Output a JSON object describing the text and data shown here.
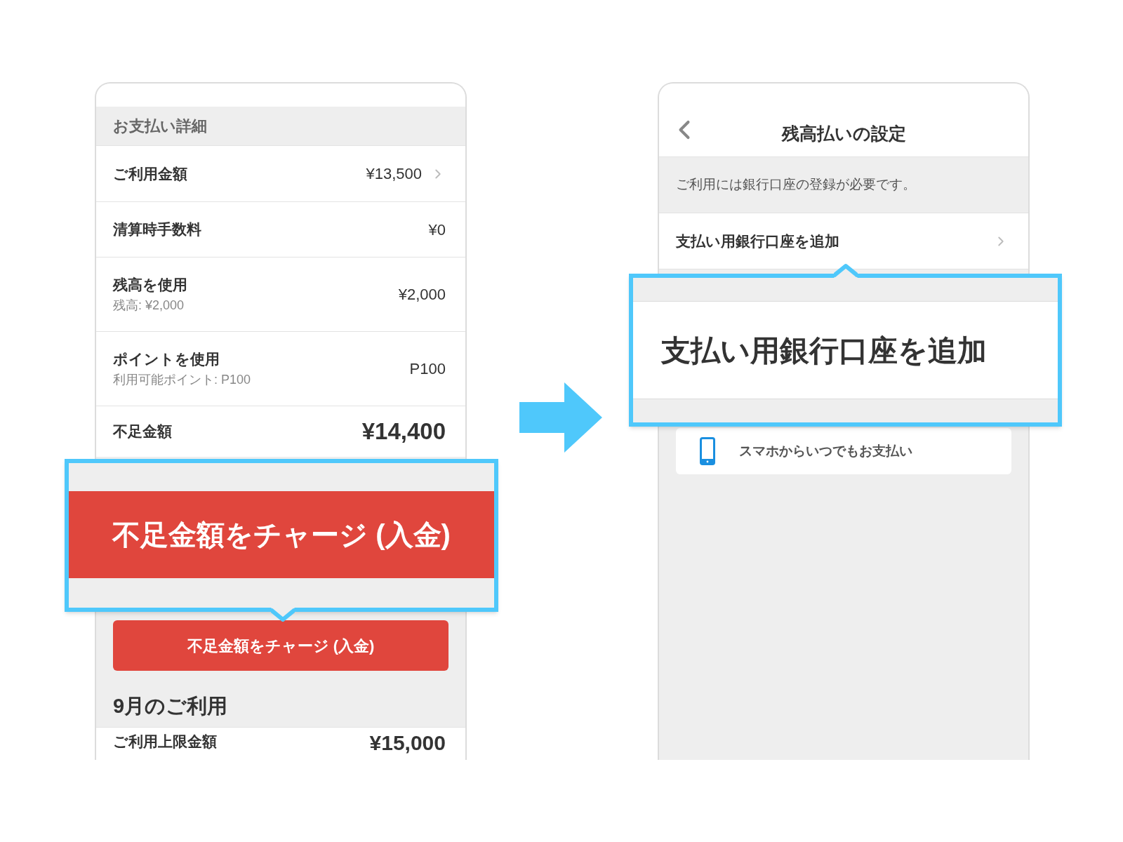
{
  "left_screen": {
    "section_header": "お支払い詳細",
    "rows": [
      {
        "kind": "link",
        "label": "ご利用金額",
        "value": "¥13,500"
      },
      {
        "kind": "plain",
        "label": "清算時手数料",
        "value": "¥0"
      },
      {
        "kind": "sub",
        "label": "残高を使用",
        "sublabel": "残高: ¥2,000",
        "value": "¥2,000"
      },
      {
        "kind": "sub",
        "label": "ポイントを使用",
        "sublabel": "利用可能ポイント: P100",
        "value": "P100"
      },
      {
        "kind": "total",
        "label": "不足金額",
        "value": "¥14,400"
      }
    ],
    "charge_button": "不足金額をチャージ (入金)",
    "month_header": "9月のご利用",
    "limit_row": {
      "label": "ご利用上限金額",
      "value": "¥15,000"
    }
  },
  "left_callout": {
    "button": "不足金額をチャージ (入金)"
  },
  "right_screen": {
    "title": "残高払いの設定",
    "notice": "ご利用には銀行口座の登録が必要です。",
    "rows": [
      {
        "label": "支払い用銀行口座を追加"
      }
    ],
    "card": {
      "text": "スマホからいつでもお支払い"
    }
  },
  "right_callout": {
    "text": "支払い用銀行口座を追加"
  }
}
